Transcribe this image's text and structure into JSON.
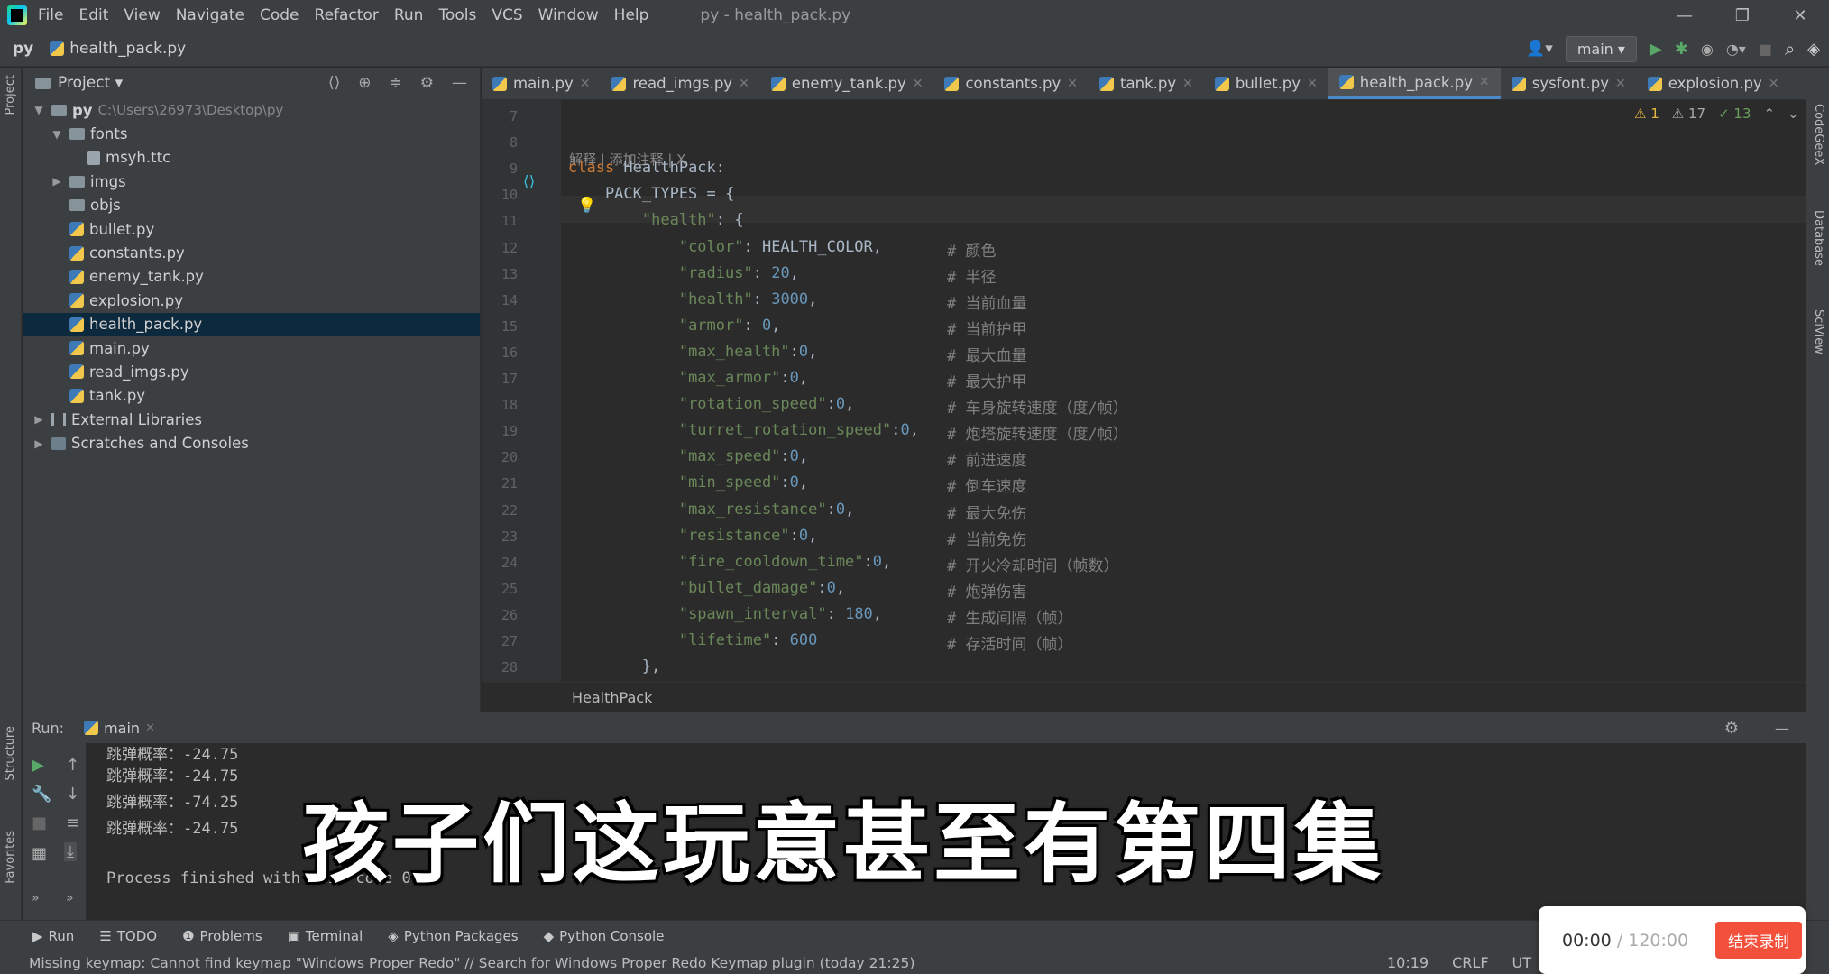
{
  "menu": [
    "File",
    "Edit",
    "View",
    "Navigate",
    "Code",
    "Refactor",
    "Run",
    "Tools",
    "VCS",
    "Window",
    "Help"
  ],
  "window_title": "py - health_pack.py",
  "nav": {
    "project": "py",
    "file": "health_pack.py",
    "branch": "main"
  },
  "project_panel": {
    "title": "Project",
    "root": "py",
    "root_path": "C:\\Users\\26973\\Desktop\\py",
    "items": [
      {
        "label": "fonts",
        "type": "folder",
        "depth": 1,
        "expanded": true
      },
      {
        "label": "msyh.ttc",
        "type": "font",
        "depth": 2
      },
      {
        "label": "imgs",
        "type": "folder",
        "depth": 1,
        "expanded": false
      },
      {
        "label": "objs",
        "type": "folder",
        "depth": 1,
        "expanded": false
      },
      {
        "label": "bullet.py",
        "type": "py",
        "depth": 1
      },
      {
        "label": "constants.py",
        "type": "py",
        "depth": 1
      },
      {
        "label": "enemy_tank.py",
        "type": "py",
        "depth": 1
      },
      {
        "label": "explosion.py",
        "type": "py",
        "depth": 1
      },
      {
        "label": "health_pack.py",
        "type": "py",
        "depth": 1,
        "selected": true
      },
      {
        "label": "main.py",
        "type": "py",
        "depth": 1
      },
      {
        "label": "read_imgs.py",
        "type": "py",
        "depth": 1
      },
      {
        "label": "tank.py",
        "type": "py",
        "depth": 1
      }
    ],
    "external_libraries": "External Libraries",
    "scratches": "Scratches and Consoles"
  },
  "tabs": [
    "main.py",
    "read_imgs.py",
    "enemy_tank.py",
    "constants.py",
    "tank.py",
    "bullet.py",
    "health_pack.py",
    "sysfont.py",
    "explosion.py"
  ],
  "active_tab": "health_pack.py",
  "inspections": {
    "errors": "1",
    "warnings": "17",
    "weak": "13"
  },
  "inlay_hint": "解释 | 添加注释 | X",
  "code_lines": [
    {
      "n": "7"
    },
    {
      "n": "8"
    },
    {
      "n": "9",
      "kw": "class",
      "name": " HealthPack:"
    },
    {
      "n": "10",
      "text": "    PACK_TYPES = {"
    },
    {
      "n": "11",
      "key": "\"health\"",
      "rest": ": {"
    },
    {
      "n": "12",
      "key": "\"color\"",
      "rest": ": HEALTH_COLOR,",
      "comment": "# 颜色"
    },
    {
      "n": "13",
      "key": "\"radius\"",
      "rest": ": ",
      "num": "20",
      "tail": ",",
      "comment": "# 半径"
    },
    {
      "n": "14",
      "key": "\"health\"",
      "rest": ": ",
      "num": "3000",
      "tail": ",",
      "comment": "# 当前血量"
    },
    {
      "n": "15",
      "key": "\"armor\"",
      "rest": ": ",
      "num": "0",
      "tail": ",",
      "comment": "# 当前护甲"
    },
    {
      "n": "16",
      "key": "\"max_health\"",
      "rest": ":",
      "num": "0",
      "tail": ",",
      "comment": "# 最大血量"
    },
    {
      "n": "17",
      "key": "\"max_armor\"",
      "rest": ":",
      "num": "0",
      "tail": ",",
      "comment": "# 最大护甲"
    },
    {
      "n": "18",
      "key": "\"rotation_speed\"",
      "rest": ":",
      "num": "0",
      "tail": ",",
      "comment": "# 车身旋转速度（度/帧）"
    },
    {
      "n": "19",
      "key": "\"turret_rotation_speed\"",
      "rest": ":",
      "num": "0",
      "tail": ",",
      "comment": "# 炮塔旋转速度（度/帧）"
    },
    {
      "n": "20",
      "key": "\"max_speed\"",
      "rest": ":",
      "num": "0",
      "tail": ",",
      "comment": "# 前进速度"
    },
    {
      "n": "21",
      "key": "\"min_speed\"",
      "rest": ":",
      "num": "0",
      "tail": ",",
      "comment": "# 倒车速度"
    },
    {
      "n": "22",
      "key": "\"max_resistance\"",
      "rest": ":",
      "num": "0",
      "tail": ",",
      "comment": "# 最大免伤"
    },
    {
      "n": "23",
      "key": "\"resistance\"",
      "rest": ":",
      "num": "0",
      "tail": ",",
      "comment": "# 当前免伤"
    },
    {
      "n": "24",
      "key": "\"fire_cooldown_time\"",
      "rest": ":",
      "num": "0",
      "tail": ",",
      "comment": "# 开火冷却时间（帧数）"
    },
    {
      "n": "25",
      "key": "\"bullet_damage\"",
      "rest": ":",
      "num": "0",
      "tail": ",",
      "comment": "# 炮弹伤害"
    },
    {
      "n": "26",
      "key": "\"spawn_interval\"",
      "rest": ": ",
      "num": "180",
      "tail": ",",
      "comment": "# 生成间隔（帧）"
    },
    {
      "n": "27",
      "key": "\"lifetime\"",
      "rest": ": ",
      "num": "600",
      "tail": "",
      "comment": "# 存活时间（帧）"
    },
    {
      "n": "28",
      "text": "        },"
    }
  ],
  "breadcrumb": "HealthPack",
  "run": {
    "label": "Run:",
    "config": "main",
    "output": [
      "跳弹概率：-24.75",
      "跳弹概率：-24.75",
      "跳弹概率：-74.25",
      "跳弹概率：-24.75",
      "",
      "Process finished with exit code 0"
    ]
  },
  "bottom_tools": [
    "Run",
    "TODO",
    "Problems",
    "Terminal",
    "Python Packages",
    "Python Console"
  ],
  "status_message": "Missing keymap: Cannot find keymap \"Windows Proper Redo\" // Search for Windows Proper Redo Keymap plugin (today 21:25)",
  "status_right": {
    "position": "10:19",
    "line_sep": "CRLF",
    "encoding": "UT"
  },
  "side_labels": {
    "project": "Project",
    "structure": "Structure",
    "favorites": "Favorites",
    "codegeex": "CodeGeeX",
    "database": "Database",
    "sciview": "SciView"
  },
  "subtitle": "孩子们这玩意甚至有第四集",
  "recorder": {
    "elapsed": "00:00",
    "total": "/ 120:00",
    "stop_label": "结束录制"
  }
}
